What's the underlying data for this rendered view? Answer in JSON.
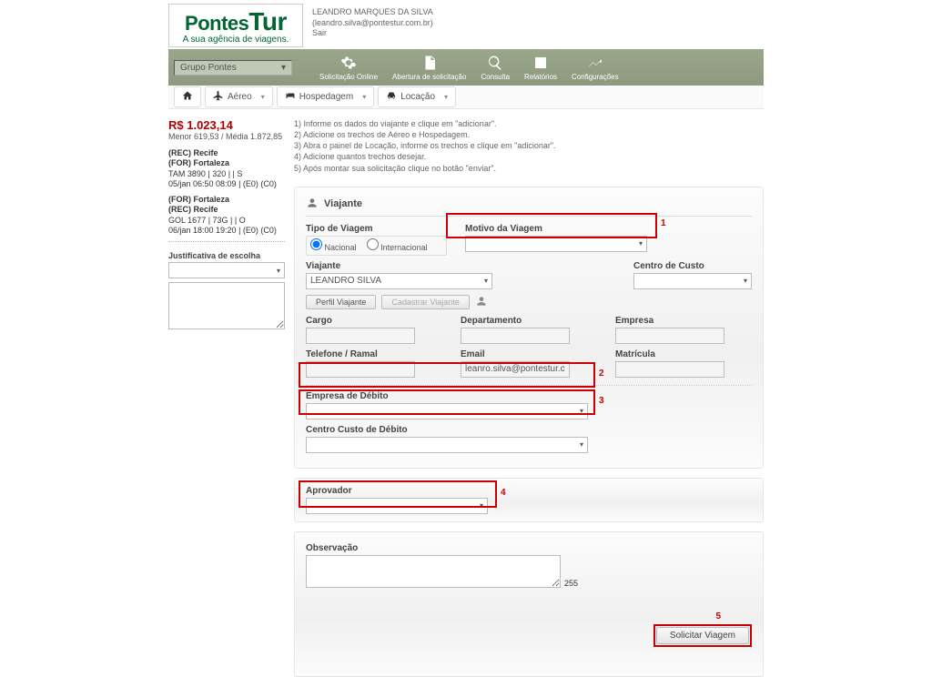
{
  "header": {
    "logo_line1_a": "Pontes",
    "logo_line1_b": "Tur",
    "logo_line2": "A sua agência de viagens.",
    "user_name": "LEANDRO MARQUES DA SILVA",
    "user_email": "(leandro.silva@pontestur.com.br)",
    "logout": "Sair"
  },
  "toolbar": {
    "group_label": "Grupo Pontes",
    "items": [
      {
        "label": "Solicitação Online"
      },
      {
        "label": "Abertura de solicitação"
      },
      {
        "label": "Consulta"
      },
      {
        "label": "Relatórios"
      },
      {
        "label": "Configurações"
      }
    ]
  },
  "subtabs": {
    "aereo": "Aéreo",
    "hospedagem": "Hospedagem",
    "locacao": "Locação"
  },
  "sidebar": {
    "total": "R$ 1.023,14",
    "avg_line": "Menor 619,53  /  Média 1.872,85",
    "leg1_l1": "(REC) Recife",
    "leg1_l2": "(FOR) Fortaleza",
    "leg1_l3": "TAM 3890 | 320 |  | S",
    "leg1_l4": "05/jan 06:50  08:09 |  (E0)  (C0)",
    "leg2_l1": "(FOR) Fortaleza",
    "leg2_l2": "(REC) Recife",
    "leg2_l3": "GOL 1677 | 73G |  | O",
    "leg2_l4": "06/jan 18:00  19:20 |  (E0)  (C0)",
    "just_label": "Justificativa de escolha"
  },
  "instructions": {
    "l1": "1) Informe os dados do viajante e clique em \"adicionar\".",
    "l2": "2) Adicione os trechos de Aéreo e Hospedagem.",
    "l3": "3) Abra o painel de Locação, informe os trechos e clique em \"adicionar\".",
    "l4": "4) Adicione quantos trechos desejar.",
    "l5": "5) Após montar sua solicitação clique no botão \"enviar\"."
  },
  "form": {
    "section_title": "Viajante",
    "tipo_viagem_label": "Tipo de Viagem",
    "radio_nacional": "Nacional",
    "radio_internacional": "Internacional",
    "motivo_label": "Motivo da Viagem",
    "viajante_label": "Viajante",
    "viajante_value": "LEANDRO SILVA",
    "centro_custo_label": "Centro de Custo",
    "perfil_btn": "Perfil Viajante",
    "cadastrar_btn": "Cadastrar Viajante",
    "cargo_label": "Cargo",
    "departamento_label": "Departamento",
    "empresa_label": "Empresa",
    "telefone_label": "Telefone / Ramal",
    "email_label": "Email",
    "email_value": "leanro.silva@pontestur.com.",
    "matricula_label": "Matrícula",
    "empresa_debito_label": "Empresa de Débito",
    "centro_custo_debito_label": "Centro Custo de Débito",
    "aprovador_label": "Aprovador",
    "observacao_label": "Observação",
    "char_count": "255",
    "submit": "Solicitar Viagem"
  },
  "annotations": {
    "n1": "1",
    "n2": "2",
    "n3": "3",
    "n4": "4",
    "n5": "5"
  }
}
